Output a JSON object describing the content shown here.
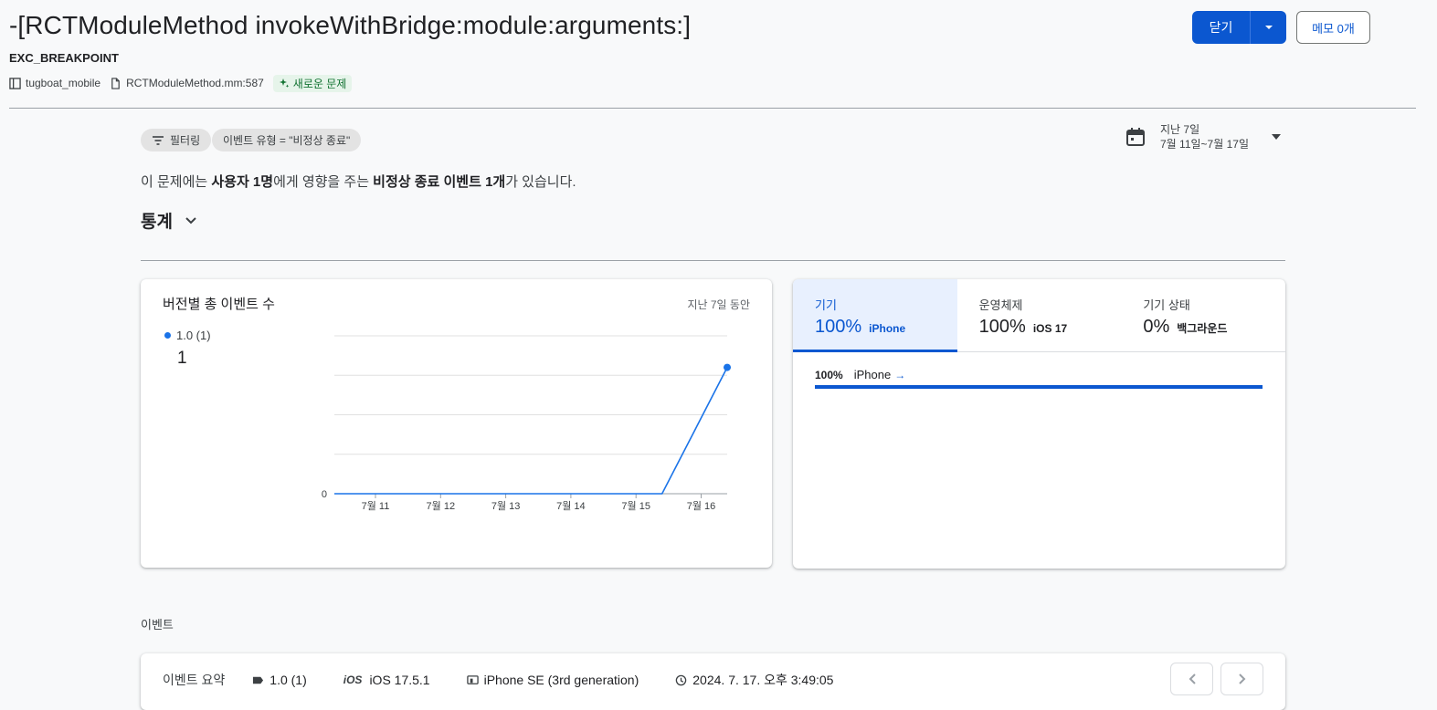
{
  "header": {
    "title": "-[RCTModuleMethod invokeWithBridge:module:arguments:]",
    "subtitle": "EXC_BREAKPOINT",
    "app": "tugboat_mobile",
    "file": "RCTModuleMethod.mm:587",
    "new_badge": "새로운 문제",
    "close_label": "닫기",
    "memo_label": "메모 0개"
  },
  "filters": {
    "filter_label": "필터링",
    "event_type_chip": "이벤트 유형 = \"비정상 종료\""
  },
  "date_range": {
    "label": "지난 7일",
    "range": "7월 11일~7월 17일"
  },
  "summary": {
    "prefix": "이 문제에는 ",
    "users": "사용자 1명",
    "middle": "에게 영향을 주는 ",
    "events": "비정상 종료 이벤트 1개",
    "suffix": "가 있습니다."
  },
  "stats": {
    "heading": "통계"
  },
  "chart_card": {
    "title": "버전별 총 이벤트 수",
    "range": "지난 7일 동안",
    "legend_label": "1.0 (1)",
    "legend_value": "1"
  },
  "chart_data": {
    "type": "line",
    "categories": [
      "7월 11",
      "7월 12",
      "7월 13",
      "7월 14",
      "7월 15",
      "7월 16"
    ],
    "series": [
      {
        "name": "1.0 (1)",
        "x": [
          "7월 11",
          "7월 12",
          "7월 13",
          "7월 14",
          "7월 15",
          "7월 15.4",
          "7월 16.4"
        ],
        "values": [
          0,
          0,
          0,
          0,
          0,
          0,
          1
        ]
      }
    ],
    "y_tick_labels": [
      "0"
    ],
    "ylim": [
      0,
      1.25
    ],
    "grid": true,
    "color": "#1a73e8"
  },
  "device_card": {
    "tabs": [
      {
        "label": "기기",
        "pct": "100%",
        "sub": "iPhone"
      },
      {
        "label": "운영체제",
        "pct": "100%",
        "sub": "iOS 17"
      },
      {
        "label": "기기 상태",
        "pct": "0%",
        "sub": "백그라운드"
      }
    ],
    "row": {
      "pct": "100%",
      "name": "iPhone",
      "arrow": "→",
      "fraction": 1.0
    },
    "accent": "#0b57d0"
  },
  "events": {
    "section_label": "이벤트",
    "summary_label": "이벤트 요약",
    "version": "1.0 (1)",
    "os_badge": "iOS",
    "os": "iOS 17.5.1",
    "device": "iPhone SE (3rd generation)",
    "time": "2024. 7. 17. 오후 3:49:05",
    "prev_icon": "chevron-left-icon",
    "next_icon": "chevron-right-icon"
  }
}
